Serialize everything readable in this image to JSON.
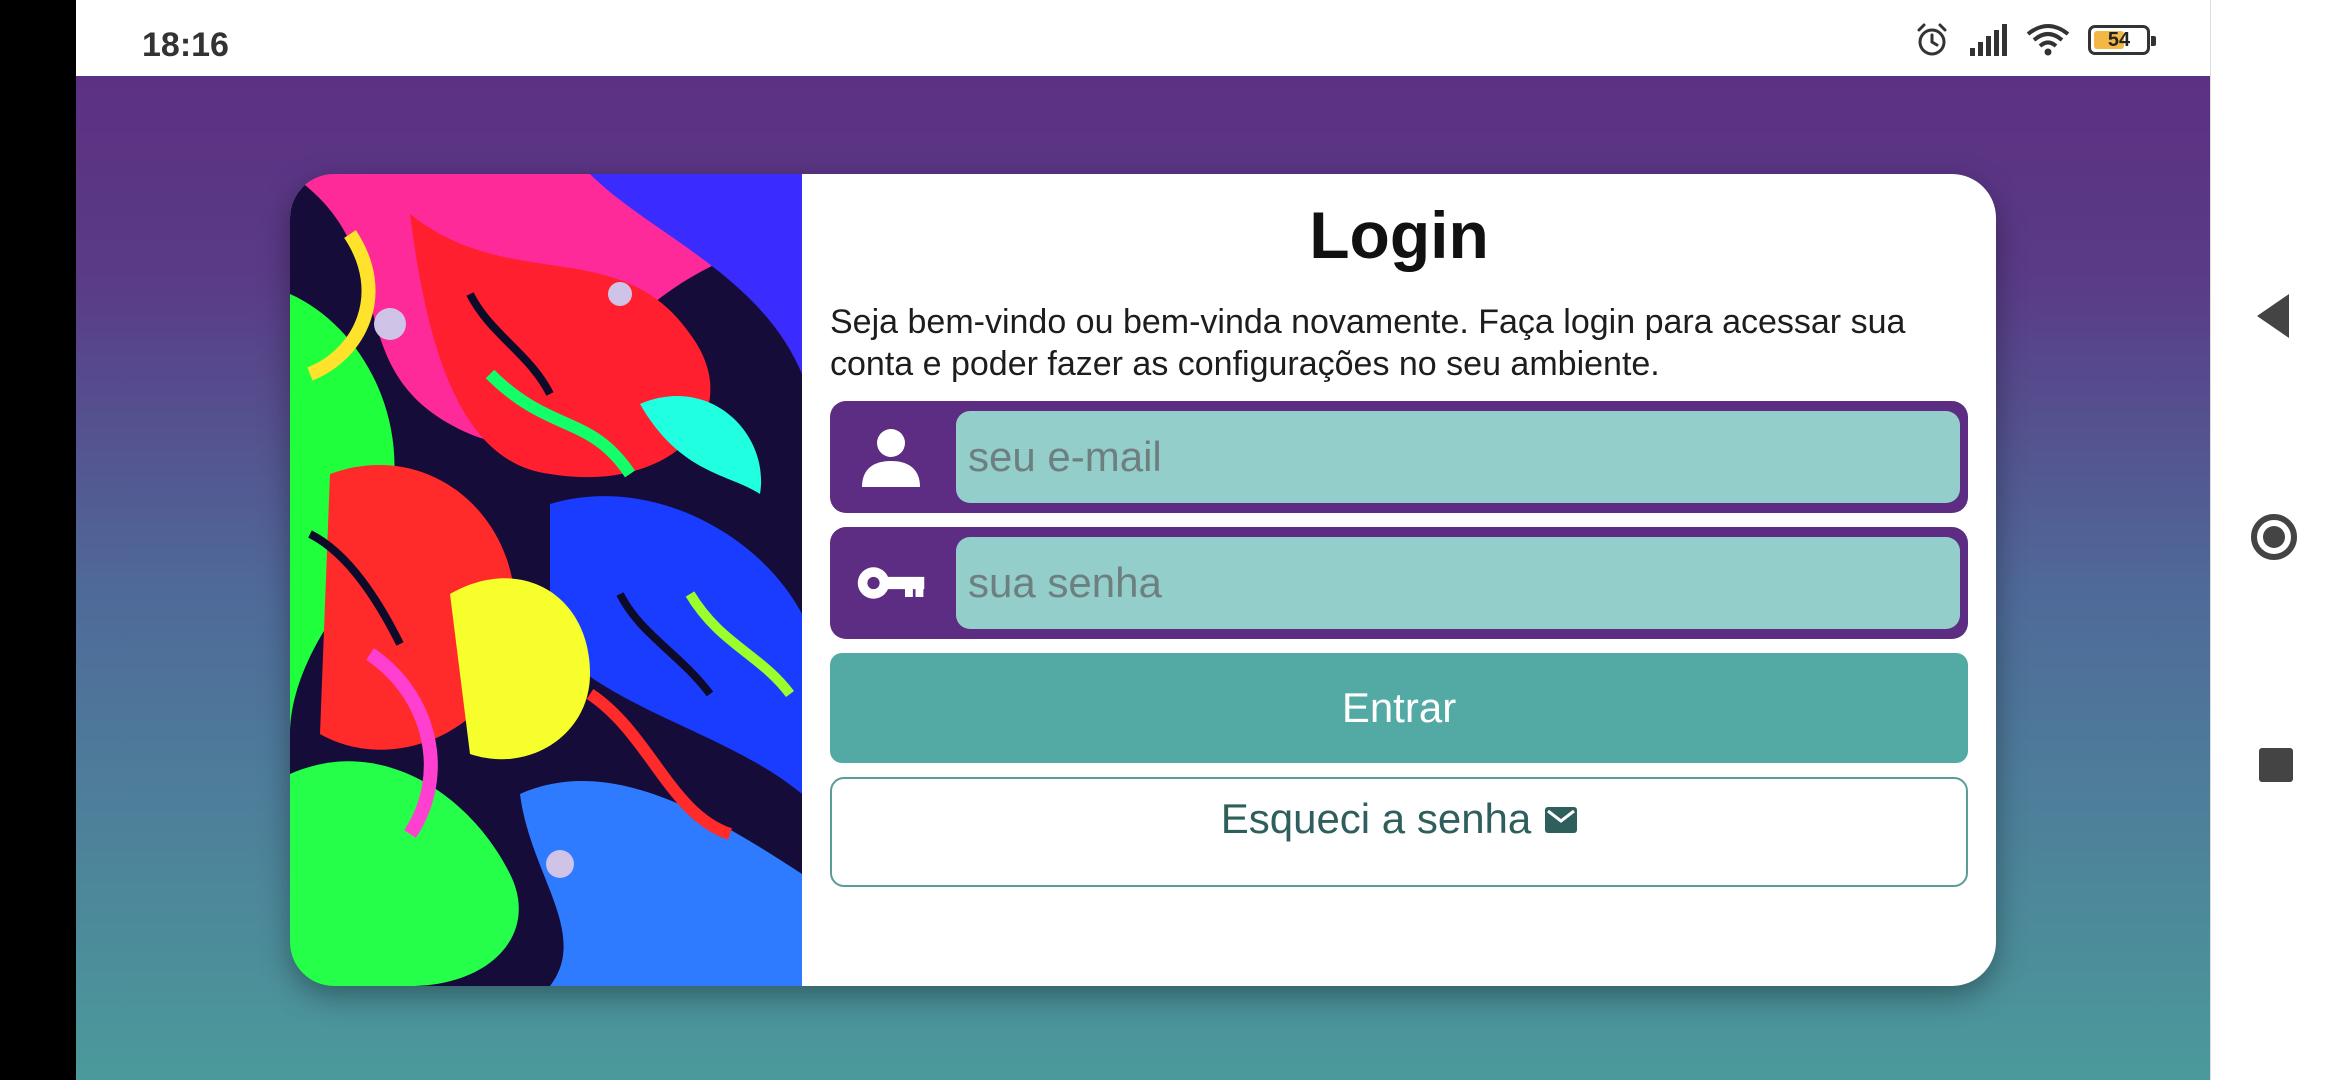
{
  "status_bar": {
    "time": "18:16",
    "battery_level": "54",
    "icons": [
      "alarm-icon",
      "signal-icon",
      "wifi-icon",
      "battery-icon"
    ]
  },
  "navigation": {
    "buttons": [
      "back-icon",
      "home-icon",
      "recents-icon"
    ]
  },
  "login": {
    "title": "Login",
    "description": "Seja bem-vindo ou bem-vinda novamente. Faça login para acessar sua conta e poder fazer as configurações no seu ambiente.",
    "email": {
      "placeholder": "seu e-mail",
      "value": "",
      "icon": "person-icon"
    },
    "password": {
      "placeholder": "sua senha",
      "value": "",
      "icon": "key-icon"
    },
    "submit_label": "Entrar",
    "forgot_label": "Esqueci a senha",
    "forgot_icon": "mail-icon"
  },
  "colors": {
    "brand_purple": "#5c2d82",
    "input_teal": "#94ceca",
    "button_teal": "#53a9a3",
    "background_gradient_top": "#5c2d82",
    "background_gradient_bottom": "#4b9a9b"
  }
}
